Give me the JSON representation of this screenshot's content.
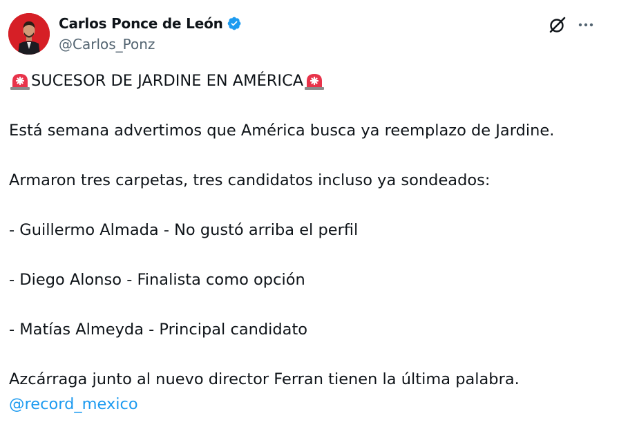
{
  "author": {
    "display_name": "Carlos Ponce de León",
    "handle": "@Carlos_Ponz",
    "verified": true,
    "avatar_bg": "#d61f26"
  },
  "actions": {
    "grok_icon": "grok-icon",
    "more_icon": "more-dots-icon"
  },
  "tweet": {
    "headline": "SUCESOR DE JARDINE EN AMÉRICA",
    "lines": [
      "Está semana advertimos que América busca ya reemplazo de Jardine.",
      "Armaron tres carpetas, tres candidatos incluso ya sondeados:",
      "- Guillermo Almada - No gustó arriba el perfil",
      "- Diego Alonso - Finalista como opción",
      "- Matías Almeyda - Principal candidato",
      "Azcárraga junto al nuevo director Ferran tienen la última palabra."
    ],
    "mention": "@record_mexico",
    "emoji": "siren-emoji"
  },
  "colors": {
    "text": "#0f1419",
    "secondary": "#536471",
    "link": "#1d9bf0",
    "verified": "#1d9bf0"
  }
}
